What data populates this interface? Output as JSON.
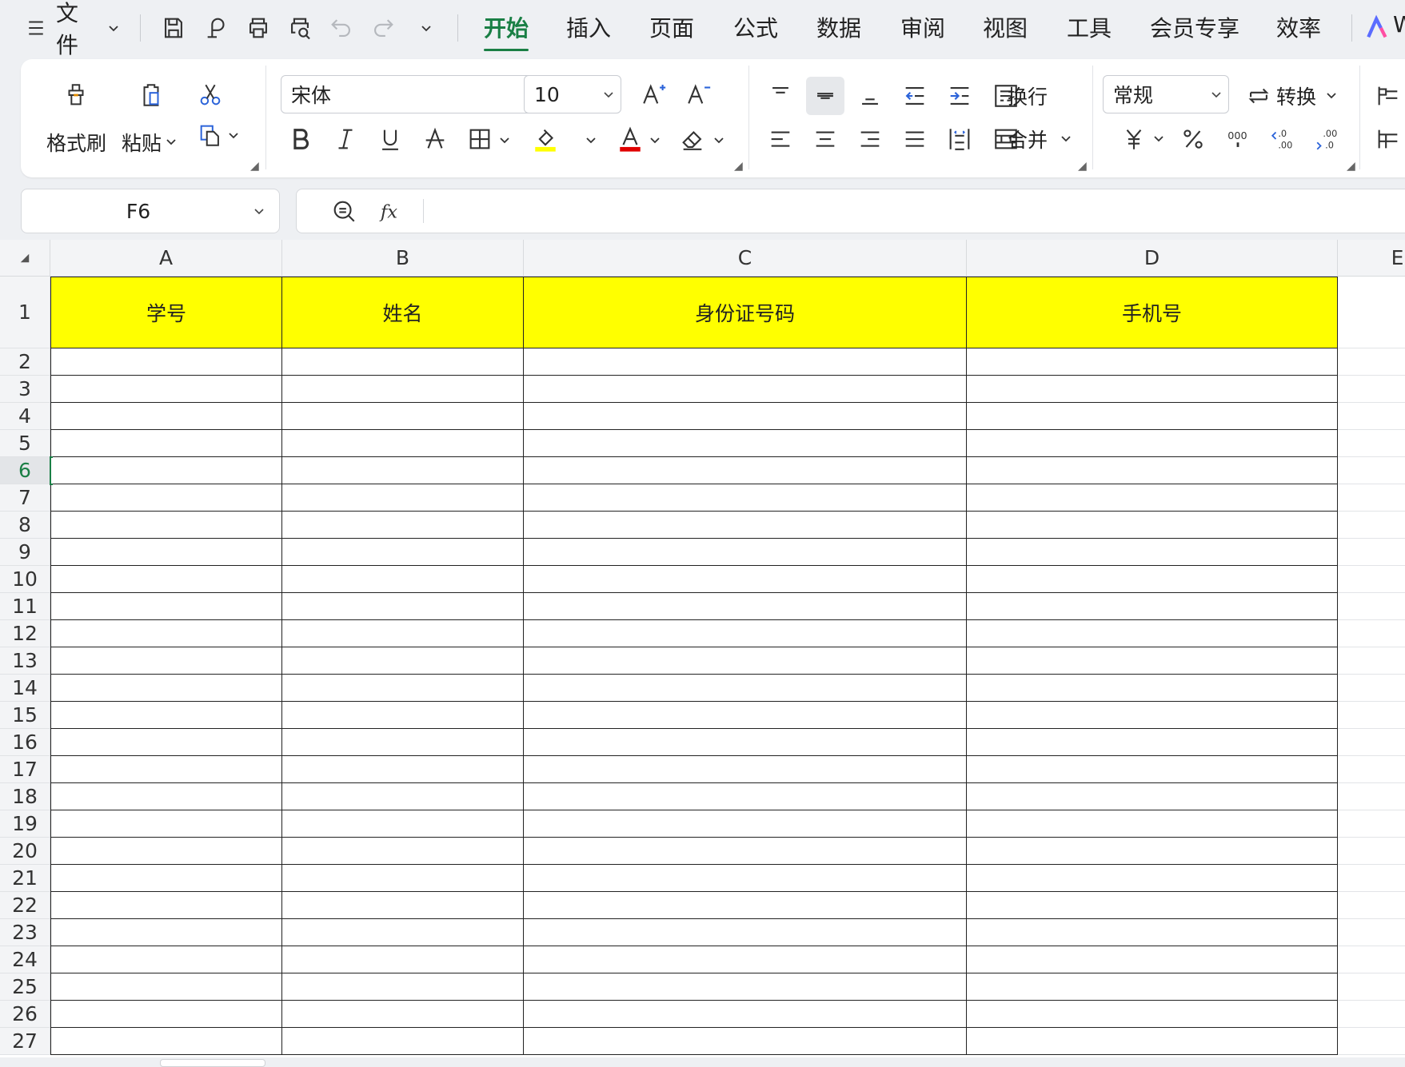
{
  "menubar": {
    "file_label": "文件",
    "tabs": [
      "开始",
      "插入",
      "页面",
      "公式",
      "数据",
      "审阅",
      "视图",
      "工具",
      "会员专享",
      "效率"
    ],
    "active_tab": "开始",
    "ai_label": "W",
    "accent_color": "#1a7f45"
  },
  "ribbon": {
    "format_painter_label": "格式刷",
    "paste_label": "粘贴",
    "font_name": "宋体",
    "font_size": "10",
    "wrap_label": "换行",
    "merge_label": "合并",
    "number_format": "常规",
    "convert_label": "转换",
    "font_color": "#e00000",
    "fill_color": "#ffff00"
  },
  "formula_bar": {
    "name_box": "F6",
    "formula": ""
  },
  "sheet": {
    "columns": [
      "A",
      "B",
      "C",
      "D",
      "E"
    ],
    "rows": [
      "1",
      "2",
      "3",
      "4",
      "5",
      "6",
      "7",
      "8",
      "9",
      "10",
      "11",
      "12",
      "13",
      "14",
      "15",
      "16",
      "17",
      "18",
      "19",
      "20",
      "21",
      "22",
      "23",
      "24",
      "25",
      "26",
      "27"
    ],
    "headers": [
      "学号",
      "姓名",
      "身份证号码",
      "手机号"
    ],
    "header_fill": "#ffff00",
    "selected_cell": "F6",
    "selected_row": "6"
  }
}
